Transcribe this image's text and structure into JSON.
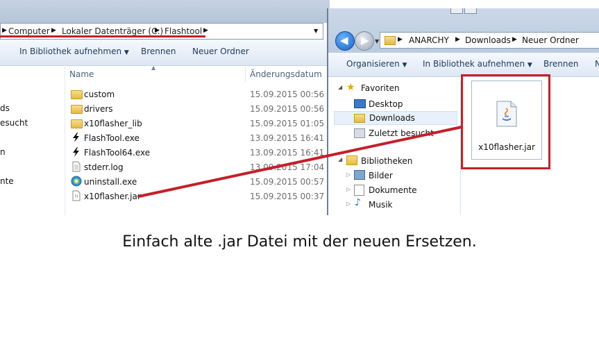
{
  "left_window": {
    "breadcrumb": [
      "Computer",
      "Lokaler Datenträger (C:)",
      "Flashtool"
    ],
    "toolbar": [
      "In Bibliothek aufnehmen",
      "Brennen",
      "Neuer Ordner"
    ],
    "columns": {
      "name": "Name",
      "date": "Änderungsdatum"
    },
    "sidebar_fragments": [
      "ds",
      "esucht",
      "n",
      "nte"
    ],
    "files": [
      {
        "name": "custom",
        "date": "15.09.2015 00:56",
        "icon": "folder-icon"
      },
      {
        "name": "drivers",
        "date": "15.09.2015 00:56",
        "icon": "folder-icon"
      },
      {
        "name": "x10flasher_lib",
        "date": "15.09.2015 01:05",
        "icon": "folder-icon"
      },
      {
        "name": "FlashTool.exe",
        "date": "13.09.2015 16:41",
        "icon": "lightning-icon"
      },
      {
        "name": "FlashTool64.exe",
        "date": "13.09.2015 16:41",
        "icon": "lightning-icon"
      },
      {
        "name": "stderr.log",
        "date": "13.09.2015 17:04",
        "icon": "document-icon"
      },
      {
        "name": "uninstall.exe",
        "date": "15.09.2015 00:57",
        "icon": "uninstall-icon"
      },
      {
        "name": "x10flasher.jar",
        "date": "15.09.2015 00:37",
        "icon": "jar-icon"
      }
    ]
  },
  "right_window": {
    "breadcrumb": [
      "ANARCHY",
      "Downloads",
      "Neuer Ordner"
    ],
    "toolbar": [
      "Organisieren",
      "In Bibliothek aufnehmen",
      "Brennen",
      "N"
    ],
    "favorites_label": "Favoriten",
    "favorites": [
      "Desktop",
      "Downloads",
      "Zuletzt besucht"
    ],
    "libraries_label": "Bibliotheken",
    "libraries": [
      "Bilder",
      "Dokumente",
      "Musik"
    ],
    "file": {
      "name": "x10flasher.jar",
      "icon": "java-jar-icon"
    }
  },
  "caption": "Einfach alte .jar Datei mit der neuen Ersetzen.",
  "colors": {
    "annotation_red": "#c41f2a",
    "toolbar_text": "#1e395b"
  }
}
